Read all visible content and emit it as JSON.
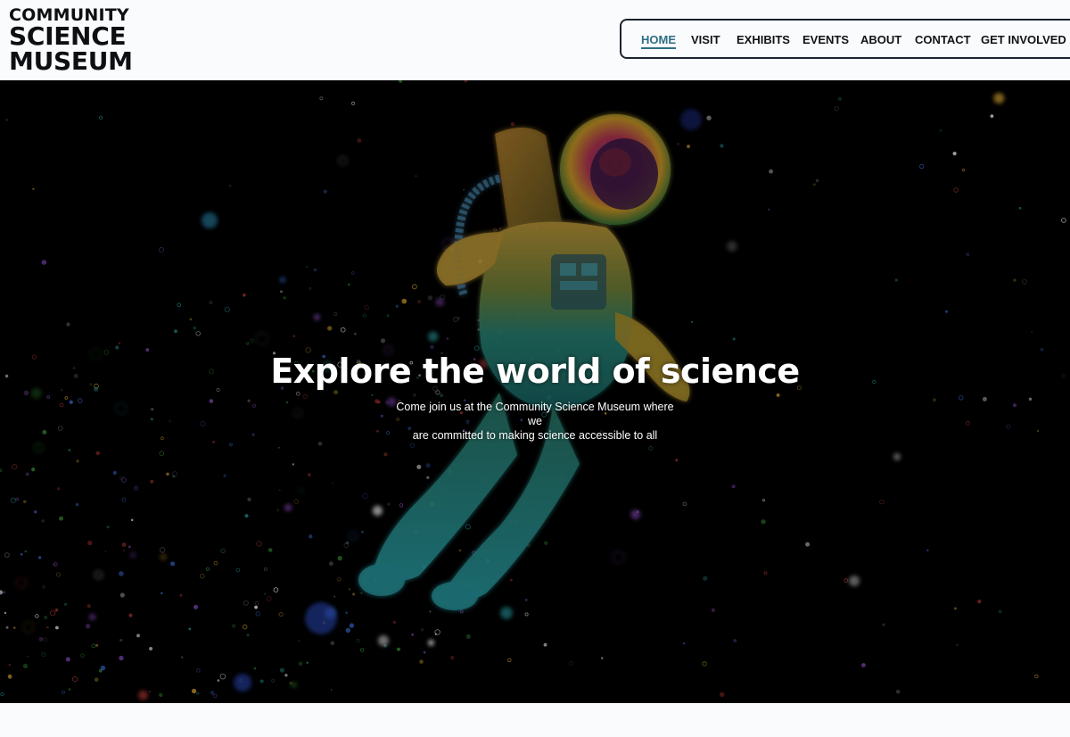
{
  "logo": {
    "line1": "COMMUNITY",
    "line2": "SCIENCE",
    "line3": "MUSEUM"
  },
  "nav": {
    "items": [
      {
        "label": "HOME",
        "active": true
      },
      {
        "label": "VISIT",
        "active": false
      },
      {
        "label": "EXHIBITS",
        "active": false
      },
      {
        "label": "EVENTS",
        "active": false
      },
      {
        "label": "ABOUT",
        "active": false
      },
      {
        "label": "CONTACT",
        "active": false
      },
      {
        "label": "GET INVOLVED",
        "active": false
      }
    ]
  },
  "hero": {
    "title": "Explore the world of science",
    "subtitle_line1": "Come join us at the Community Science Museum where we",
    "subtitle_line2": "are committed to making science accessible to all",
    "image": "astronaut-illustration"
  },
  "colors": {
    "accent": "#2e6f86",
    "text_dark": "#111318",
    "hero_bg": "#000000",
    "page_bg": "#fafbfc"
  }
}
